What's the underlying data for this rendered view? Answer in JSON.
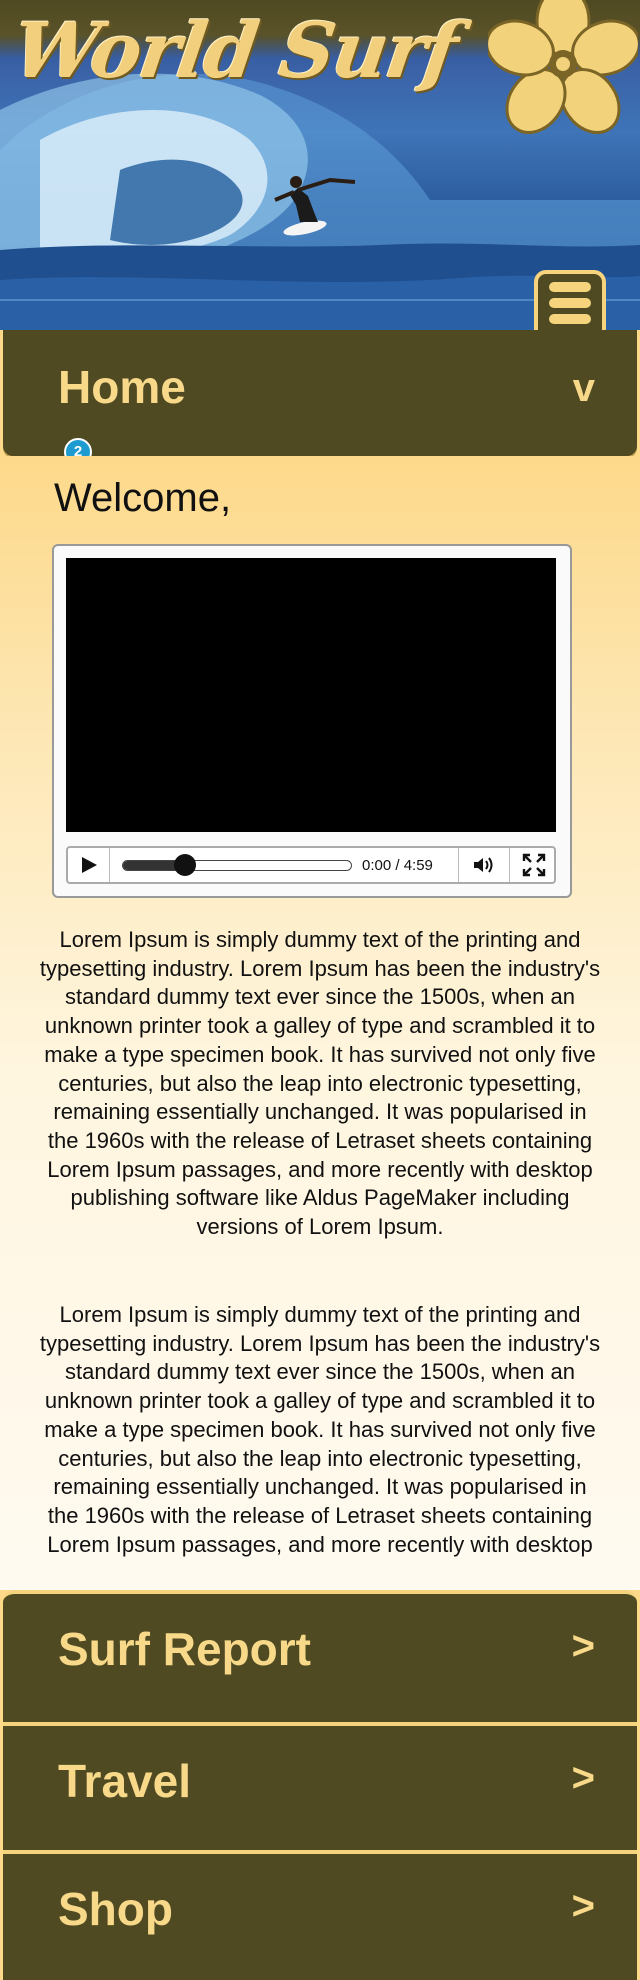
{
  "header": {
    "logo_text": "World Surf"
  },
  "nav": {
    "home": {
      "label": "Home",
      "chevron": "v"
    },
    "badge": "2",
    "items": [
      {
        "label": "Surf Report",
        "chevron": ">"
      },
      {
        "label": "Travel",
        "chevron": ">"
      },
      {
        "label": "Shop",
        "chevron": ">"
      }
    ]
  },
  "main": {
    "welcome": "Welcome,",
    "video": {
      "time": "0:00 / 4:59",
      "progress_fraction": 0.27
    },
    "paragraph1": "Lorem Ipsum is simply dummy text of the printing and typesetting industry. Lorem Ipsum has been the industry's standard dummy text ever since the 1500s, when an unknown printer took a galley of type and scrambled it to make a type specimen book. It has survived not only five centuries, but also the leap into electronic typesetting, remaining essentially unchanged. It was popularised in the 1960s with the release of Letraset sheets containing Lorem Ipsum passages, and more recently with desktop publishing software like Aldus PageMaker including versions of Lorem Ipsum.",
    "paragraph2": "Lorem Ipsum is simply dummy text of the printing and typesetting industry. Lorem Ipsum has been the industry's standard dummy text ever since the 1500s, when an unknown printer took a galley of type and scrambled it to make a type specimen book. It has survived not only five centuries, but also the leap into electronic typesetting, remaining essentially unchanged. It was popularised in the 1960s with the release of Letraset sheets containing Lorem Ipsum passages, and more recently with desktop publishing software like Aldus PageMaker including versions of Lorem Ipsum."
  },
  "icons": {
    "menu": "hamburger-menu-icon",
    "flower": "hibiscus-flower-icon",
    "play": "play-icon",
    "volume": "volume-icon",
    "fullscreen": "fullscreen-icon"
  },
  "colors": {
    "bar": "#4f4a22",
    "accent": "#f8d98a",
    "badge": "#1e9bd0"
  }
}
